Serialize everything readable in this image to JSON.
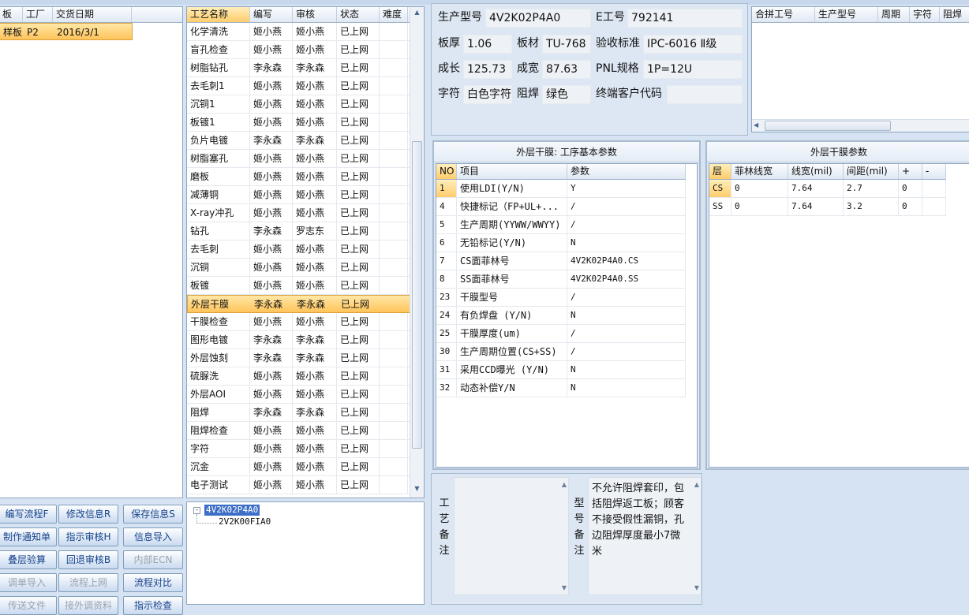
{
  "order_list": {
    "headers": [
      "板",
      "工厂",
      "交货日期"
    ],
    "rows": [
      {
        "c0": "样板",
        "c1": "P2",
        "c2": "2016/3/1"
      }
    ]
  },
  "buttons": {
    "b1": "编写流程F",
    "b2": "修改信息R",
    "b3": "保存信息S",
    "b4": "制作通知单",
    "b5": "指示审核H",
    "b6": "信息导入",
    "b7": "叠层验算",
    "b8": "回退审核B",
    "b9": "内部ECN",
    "b10": "调单导入",
    "b11": "流程上网",
    "b12": "流程对比",
    "b13": "传送文件",
    "b14": "接外调资料",
    "b15": "指示检查"
  },
  "process_list": {
    "headers": [
      "工艺名称",
      "编写",
      "审核",
      "状态",
      "难度"
    ],
    "rows": [
      {
        "name": "化学清洗",
        "writer": "姬小燕",
        "reviewer": "姬小燕",
        "status": "已上网"
      },
      {
        "name": "盲孔检查",
        "writer": "姬小燕",
        "reviewer": "姬小燕",
        "status": "已上网"
      },
      {
        "name": "树脂钻孔",
        "writer": "李永森",
        "reviewer": "李永森",
        "status": "已上网"
      },
      {
        "name": "去毛刺1",
        "writer": "姬小燕",
        "reviewer": "姬小燕",
        "status": "已上网"
      },
      {
        "name": "沉铜1",
        "writer": "姬小燕",
        "reviewer": "姬小燕",
        "status": "已上网"
      },
      {
        "name": "板镀1",
        "writer": "姬小燕",
        "reviewer": "姬小燕",
        "status": "已上网"
      },
      {
        "name": "负片电镀",
        "writer": "李永森",
        "reviewer": "李永森",
        "status": "已上网"
      },
      {
        "name": "树脂塞孔",
        "writer": "姬小燕",
        "reviewer": "姬小燕",
        "status": "已上网"
      },
      {
        "name": "磨板",
        "writer": "姬小燕",
        "reviewer": "姬小燕",
        "status": "已上网"
      },
      {
        "name": "减薄铜",
        "writer": "姬小燕",
        "reviewer": "姬小燕",
        "status": "已上网"
      },
      {
        "name": "X-ray冲孔",
        "writer": "姬小燕",
        "reviewer": "姬小燕",
        "status": "已上网"
      },
      {
        "name": "钻孔",
        "writer": "李永森",
        "reviewer": "罗志东",
        "status": "已上网"
      },
      {
        "name": "去毛刺",
        "writer": "姬小燕",
        "reviewer": "姬小燕",
        "status": "已上网"
      },
      {
        "name": "沉铜",
        "writer": "姬小燕",
        "reviewer": "姬小燕",
        "status": "已上网"
      },
      {
        "name": "板镀",
        "writer": "姬小燕",
        "reviewer": "姬小燕",
        "status": "已上网"
      },
      {
        "name": "外层干膜",
        "writer": "李永森",
        "reviewer": "李永森",
        "status": "已上网"
      },
      {
        "name": "干膜检查",
        "writer": "姬小燕",
        "reviewer": "姬小燕",
        "status": "已上网"
      },
      {
        "name": "图形电镀",
        "writer": "李永森",
        "reviewer": "李永森",
        "status": "已上网"
      },
      {
        "name": "外层蚀刻",
        "writer": "李永森",
        "reviewer": "李永森",
        "status": "已上网"
      },
      {
        "name": "硫脲洗",
        "writer": "姬小燕",
        "reviewer": "姬小燕",
        "status": "已上网"
      },
      {
        "name": "外层AOI",
        "writer": "姬小燕",
        "reviewer": "姬小燕",
        "status": "已上网"
      },
      {
        "name": "阻焊",
        "writer": "李永森",
        "reviewer": "李永森",
        "status": "已上网"
      },
      {
        "name": "阻焊检查",
        "writer": "姬小燕",
        "reviewer": "姬小燕",
        "status": "已上网"
      },
      {
        "name": "字符",
        "writer": "姬小燕",
        "reviewer": "姬小燕",
        "status": "已上网"
      },
      {
        "name": "沉金",
        "writer": "姬小燕",
        "reviewer": "姬小燕",
        "status": "已上网"
      },
      {
        "name": "电子测试",
        "writer": "姬小燕",
        "reviewer": "姬小燕",
        "status": "已上网"
      }
    ]
  },
  "tree": {
    "root": "4V2K02P4A0",
    "child": "2V2K00FIA0"
  },
  "info": {
    "model_label": "生产型号",
    "model": "4V2K02P4A0",
    "e_label": "E工号",
    "e_no": "792141",
    "thick_label": "板厚",
    "thick": "1.06",
    "material_label": "板材",
    "material": "TU-768",
    "std_label": "验收标准",
    "std": "IPC-6016 Ⅱ级",
    "len_label": "成长",
    "len": "125.73",
    "wid_label": "成宽",
    "wid": "87.63",
    "pnl_label": "PNL规格",
    "pnl": "1P=12U",
    "char_label": "字符",
    "char": "白色字符",
    "mask_label": "阻焊",
    "mask": "绿色",
    "cust_label": "终端客户代码",
    "cust": ""
  },
  "combine": {
    "headers": [
      "合拼工号",
      "生产型号",
      "周期",
      "字符",
      "阻焊"
    ]
  },
  "basic_params": {
    "title": "外层干膜: 工序基本参数",
    "headers": [
      "NO",
      "项目",
      "参数"
    ],
    "rows": [
      {
        "no": "1",
        "item": "使用LDI(Y/N)",
        "val": "Y"
      },
      {
        "no": "4",
        "item": "快捷标记（FP+UL+...",
        "val": "/"
      },
      {
        "no": "5",
        "item": "生产周期(YYWW/WWYY)",
        "val": "/"
      },
      {
        "no": "6",
        "item": "无铅标记(Y/N)",
        "val": "N"
      },
      {
        "no": "7",
        "item": "CS面菲林号",
        "val": "4V2K02P4A0.CS"
      },
      {
        "no": "8",
        "item": "SS面菲林号",
        "val": "4V2K02P4A0.SS"
      },
      {
        "no": "23",
        "item": "干膜型号",
        "val": "/"
      },
      {
        "no": "24",
        "item": "有负焊盘 (Y/N)",
        "val": "N"
      },
      {
        "no": "25",
        "item": "干膜厚度(um)",
        "val": "/"
      },
      {
        "no": "30",
        "item": "生产周期位置(CS+SS)",
        "val": "/"
      },
      {
        "no": "31",
        "item": "采用CCD曝光 (Y/N)",
        "val": "N"
      },
      {
        "no": "32",
        "item": "动态补偿Y/N",
        "val": "N"
      }
    ]
  },
  "film_params": {
    "title": "外层干膜参数",
    "headers": [
      "层",
      "菲林线宽",
      "线宽(mil)",
      "间距(mil)",
      "+",
      "-"
    ],
    "rows": [
      {
        "layer": "CS",
        "film": "0",
        "lw": "7.64",
        "sp": "2.7",
        "plus": "0",
        "minus": ""
      },
      {
        "layer": "SS",
        "film": "0",
        "lw": "7.64",
        "sp": "3.2",
        "plus": "0",
        "minus": ""
      }
    ]
  },
  "remarks": {
    "process_label": "工艺备注",
    "process_text": "",
    "model_label": "型号备注",
    "model_text": "不允许阻焊套印，包括阻焊返工板；顾客不接受假性漏铜，孔边阻焊厚度最小7微米"
  }
}
